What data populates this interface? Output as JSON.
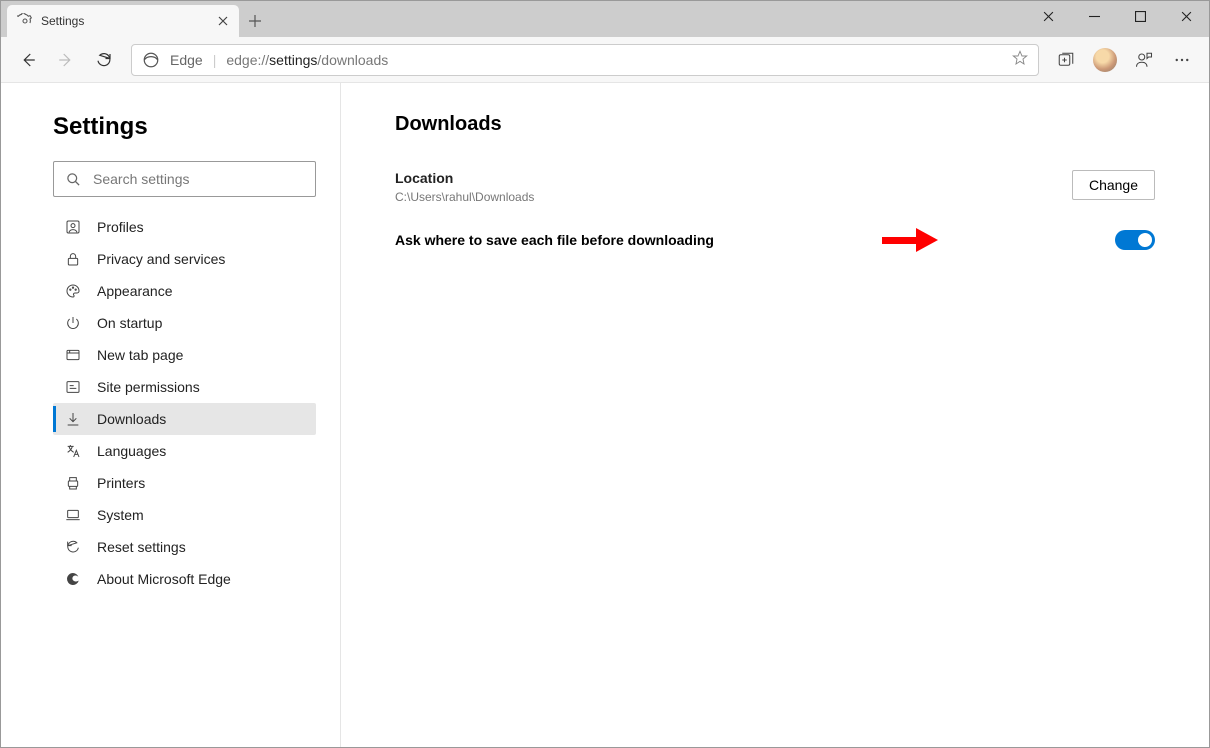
{
  "tab": {
    "title": "Settings"
  },
  "toolbar": {
    "edge_label": "Edge",
    "url_prefix": "edge://",
    "url_bold": "settings",
    "url_suffix": "/downloads"
  },
  "sidebar": {
    "heading": "Settings",
    "search_placeholder": "Search settings",
    "items": [
      {
        "label": "Profiles"
      },
      {
        "label": "Privacy and services"
      },
      {
        "label": "Appearance"
      },
      {
        "label": "On startup"
      },
      {
        "label": "New tab page"
      },
      {
        "label": "Site permissions"
      },
      {
        "label": "Downloads"
      },
      {
        "label": "Languages"
      },
      {
        "label": "Printers"
      },
      {
        "label": "System"
      },
      {
        "label": "Reset settings"
      },
      {
        "label": "About Microsoft Edge"
      }
    ]
  },
  "main": {
    "heading": "Downloads",
    "location_label": "Location",
    "location_path": "C:\\Users\\rahul\\Downloads",
    "change_label": "Change",
    "ask_label": "Ask where to save each file before downloading",
    "toggle_on": true
  },
  "colors": {
    "accent": "#0078d4",
    "arrow": "#ff0000"
  }
}
